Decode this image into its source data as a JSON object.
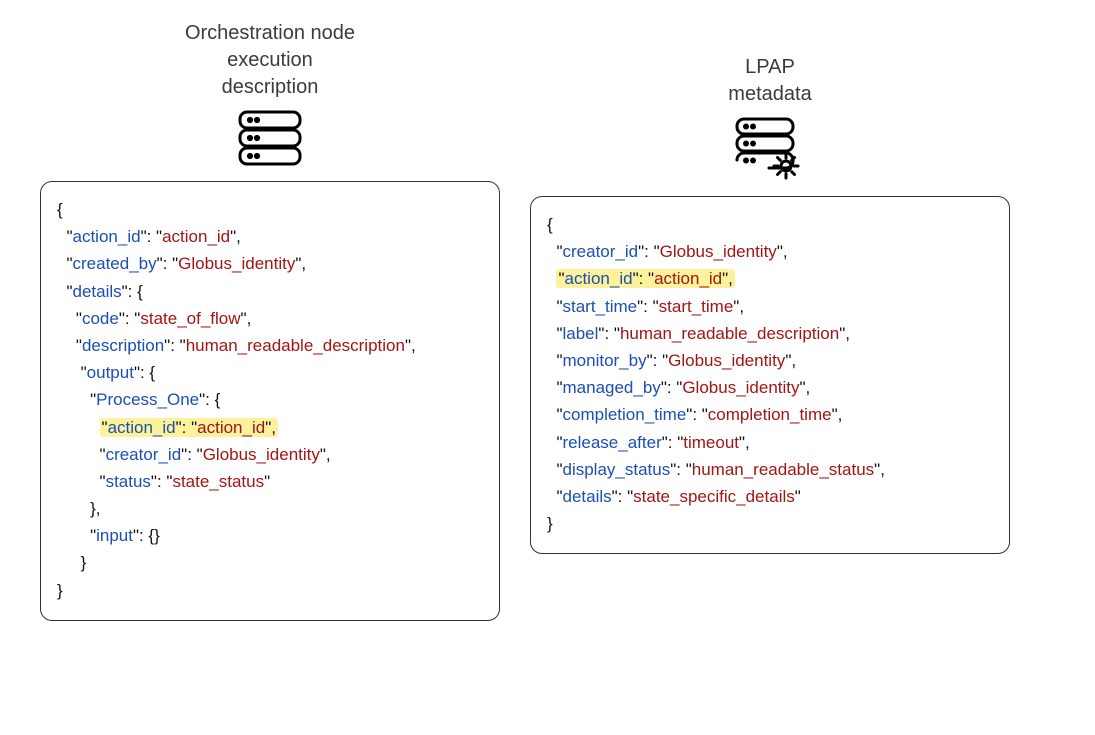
{
  "left": {
    "title_line1": "Orchestration node",
    "title_line2": "execution",
    "title_line3": "description",
    "json": {
      "action_id_key": "action_id",
      "action_id_val": "action_id",
      "created_by_key": "created_by",
      "created_by_val": "Globus_identity",
      "details_key": "details",
      "code_key": "code",
      "code_val": "state_of_flow",
      "description_key": "description",
      "description_val": "human_readable_description",
      "output_key": "output",
      "process_one_key": "Process_One",
      "po_action_id_key": "action_id",
      "po_action_id_val": "action_id",
      "po_creator_id_key": "creator_id",
      "po_creator_id_val": "Globus_identity",
      "po_status_key": "status",
      "po_status_val": "state_status",
      "input_key": "input"
    }
  },
  "right": {
    "title_line1": "LPAP",
    "title_line2": "metadata",
    "json": {
      "creator_id_key": "creator_id",
      "creator_id_val": "Globus_identity",
      "action_id_key": "action_id",
      "action_id_val": "action_id",
      "start_time_key": "start_time",
      "start_time_val": "start_time",
      "label_key": "label",
      "label_val": "human_readable_description",
      "monitor_by_key": "monitor_by",
      "monitor_by_val": "Globus_identity",
      "managed_by_key": "managed_by",
      "managed_by_val": "Globus_identity",
      "completion_time_key": "completion_time",
      "completion_time_val": "completion_time",
      "release_after_key": "release_after",
      "release_after_val": "timeout",
      "display_status_key": "display_status",
      "display_status_val": "human_readable_status",
      "details_key": "details",
      "details_val": "state_specific_details"
    }
  }
}
